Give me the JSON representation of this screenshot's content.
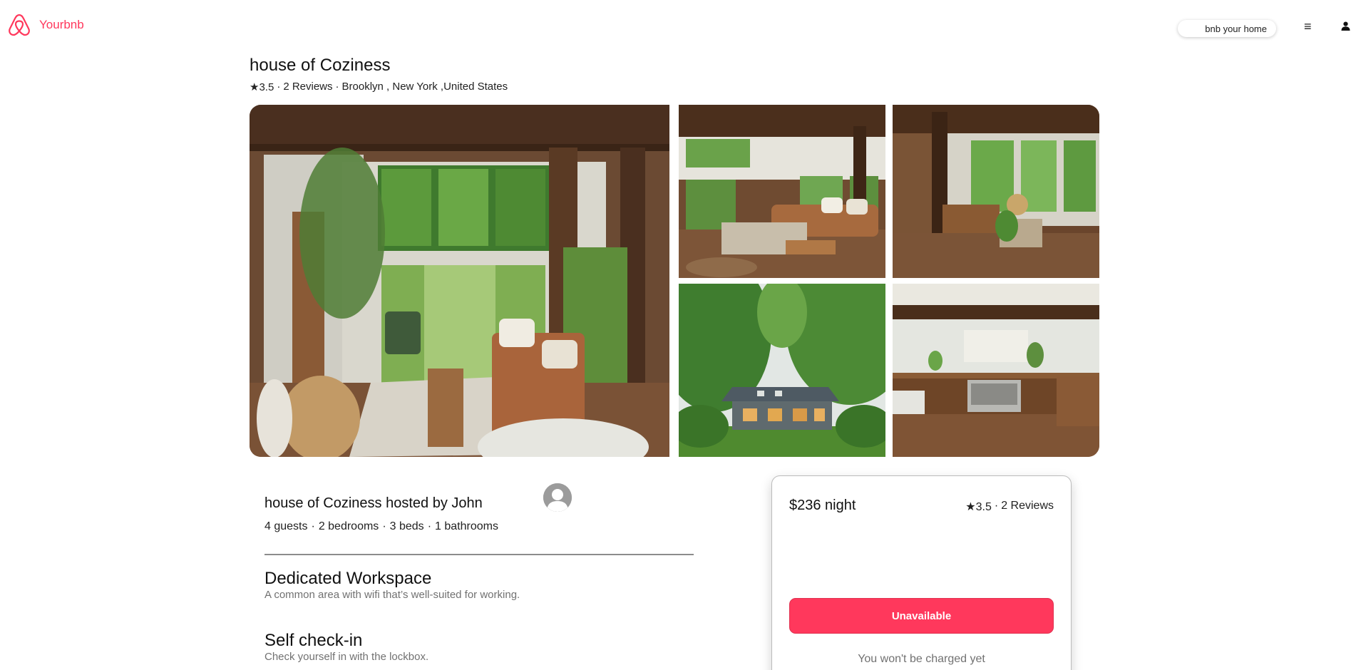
{
  "header": {
    "brand": "Yourbnb",
    "host_button": "bnb your home",
    "menu_glyph": "≡",
    "icons": [
      "airbnb-logo-icon",
      "menu-icon",
      "user-icon"
    ],
    "brand_color": "#ff385c"
  },
  "listing": {
    "title": "house of Coziness",
    "rating": "★3.5",
    "reviews": "2 Reviews",
    "location": "Brooklyn , New York ,United States",
    "separator": "·"
  },
  "gallery": {
    "photos": [
      "living-room-main-photo",
      "living-room-sofa-photo",
      "living-room-beams-photo",
      "house-exterior-photo",
      "kitchen-photo"
    ]
  },
  "host": {
    "title": "house of Coziness hosted by John",
    "guests": "4 guests",
    "bedrooms": "2 bedrooms",
    "beds": "3 beds",
    "bathrooms": "1 bathrooms",
    "sep1": "·",
    "sep2": "·",
    "sep3": "·"
  },
  "features": [
    {
      "title": "Dedicated Workspace",
      "desc": "A common area with wifi that’s well-suited for working."
    },
    {
      "title": "Self check-in",
      "desc": "Check yourself in with the lockbox."
    }
  ],
  "booking": {
    "price": "$236 night",
    "rating": "★3.5",
    "sep": "·",
    "reviews": "2 Reviews",
    "button": "Unavailable",
    "note": "You won't be charged yet"
  }
}
